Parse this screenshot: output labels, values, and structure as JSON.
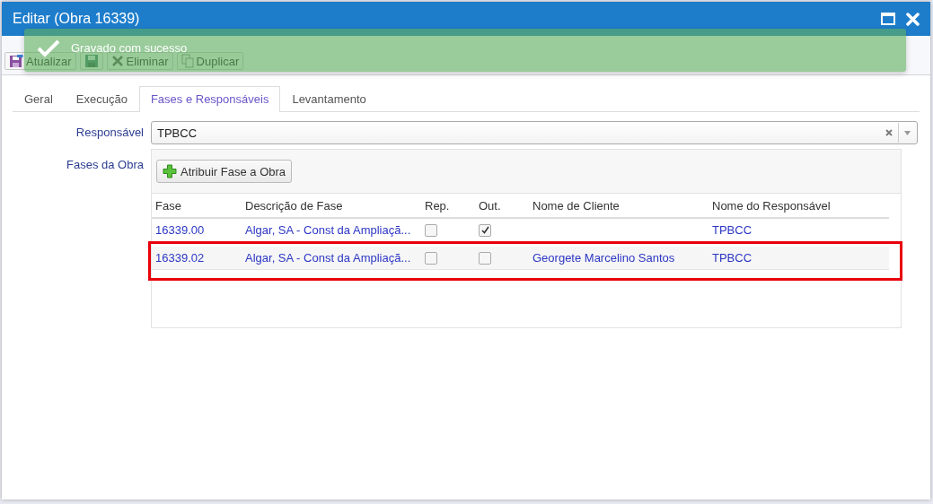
{
  "window": {
    "title": "Editar (Obra 16339)"
  },
  "toast": {
    "message": "Gravado com sucesso"
  },
  "toolbar": [
    {
      "kind": "refresh",
      "label": "Atualizar"
    },
    {
      "kind": "save"
    },
    {
      "kind": "delete",
      "label": "Eliminar"
    },
    {
      "kind": "duplicate",
      "label": "Duplicar"
    }
  ],
  "tabs": [
    {
      "label": "Geral",
      "selected": false
    },
    {
      "label": "Execução",
      "selected": false
    },
    {
      "label": "Fases e Responsáveis",
      "selected": true
    },
    {
      "label": "Levantamento",
      "selected": false
    }
  ],
  "responsavel": {
    "label": "Responsável",
    "value": "TPBCC"
  },
  "fases": {
    "label": "Fases da Obra",
    "add_button": "Atribuir Fase a Obra",
    "columns": [
      "Fase",
      "Descrição de Fase",
      "Rep.",
      "Out.",
      "Nome de Cliente",
      "Nome do Responsável"
    ],
    "rows": [
      {
        "fase": "16339.00",
        "descricao": "Algar, SA - Const da Ampliaçã...",
        "rep": false,
        "out": true,
        "cliente": "",
        "responsavel": "TPBCC",
        "highlighted": false
      },
      {
        "fase": "16339.02",
        "descricao": "Algar, SA - Const da Ampliaçã...",
        "rep": false,
        "out": false,
        "cliente": "Georgete Marcelino Santos",
        "responsavel": "TPBCC",
        "highlighted": true
      }
    ]
  }
}
